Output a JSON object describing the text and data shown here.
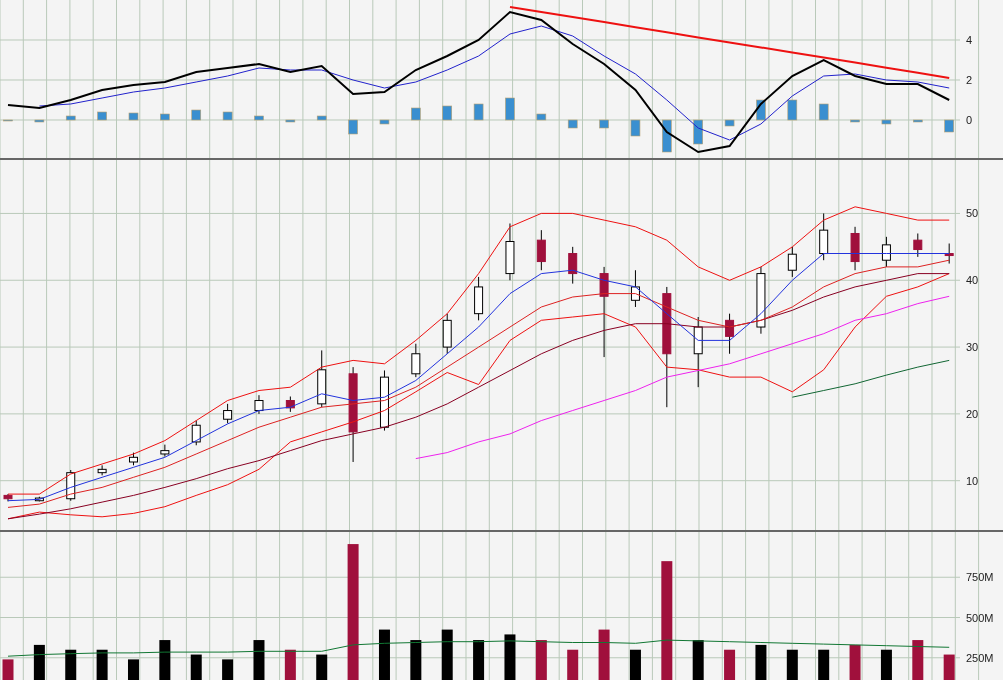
{
  "macd_panel": {
    "chart_data": {
      "type": "line",
      "grid": true,
      "ylim": [
        -1.9,
        6
      ],
      "yticks": [
        0,
        2,
        4
      ],
      "series": [
        {
          "type": "bar",
          "color": "#3a8fd0",
          "values": [
            -0.05,
            -0.1,
            0.2,
            0.4,
            0.35,
            0.3,
            0.5,
            0.4,
            0.2,
            -0.1,
            0.2,
            -0.7,
            -0.2,
            0.6,
            0.7,
            0.8,
            1.1,
            0.3,
            -0.4,
            -0.4,
            -0.8,
            -1.6,
            -1.2,
            -0.3,
            1.0,
            1.0,
            0.8,
            -0.1,
            -0.2,
            -0.1,
            -0.6
          ]
        },
        {
          "type": "line",
          "color": "#2222cc",
          "values": [
            null,
            0.7,
            0.8,
            1.1,
            1.4,
            1.6,
            1.9,
            2.2,
            2.6,
            2.5,
            2.5,
            2.0,
            1.6,
            1.9,
            2.5,
            3.2,
            4.3,
            4.7,
            4.2,
            3.2,
            2.3,
            1.0,
            -0.4,
            -1.0,
            -0.2,
            1.2,
            2.2,
            2.3,
            2.0,
            1.9,
            1.6
          ]
        },
        {
          "type": "line",
          "color": "#000000",
          "values": [
            0.75,
            0.6,
            1.0,
            1.5,
            1.75,
            1.9,
            2.4,
            2.6,
            2.8,
            2.4,
            2.7,
            1.3,
            1.4,
            2.5,
            3.2,
            4.0,
            5.4,
            5.0,
            3.8,
            2.8,
            1.5,
            -0.6,
            -1.6,
            -1.3,
            0.8,
            2.2,
            3.0,
            2.2,
            1.8,
            1.8,
            1.0
          ]
        },
        {
          "type": "line",
          "color": "#ee1111",
          "values": [
            null,
            null,
            null,
            null,
            null,
            null,
            null,
            null,
            null,
            null,
            null,
            null,
            null,
            null,
            null,
            null,
            5.65,
            5.4,
            5.15,
            4.9,
            4.64,
            4.39,
            4.13,
            3.88,
            3.63,
            3.38,
            3.12,
            2.87,
            2.61,
            2.36,
            2.1
          ]
        }
      ]
    }
  },
  "price_panel": {
    "chart_data": {
      "type": "candlestick",
      "grid": true,
      "ylim": [
        2.32,
        58
      ],
      "yticks": [
        10,
        20,
        30,
        40,
        50
      ],
      "ohlc": [
        [
          7.8,
          8.0,
          6.9,
          7.3
        ],
        [
          7.0,
          7.6,
          6.9,
          7.4
        ],
        [
          7.3,
          11.6,
          7.0,
          11.2
        ],
        [
          11.2,
          12.3,
          10.8,
          11.7
        ],
        [
          12.8,
          14.2,
          12.3,
          13.5
        ],
        [
          14.0,
          15.4,
          13.6,
          14.5
        ],
        [
          15.8,
          19.0,
          15.3,
          18.3
        ],
        [
          19.2,
          21.5,
          18.6,
          20.5
        ],
        [
          20.5,
          22.8,
          20.0,
          22.0
        ],
        [
          22.0,
          22.6,
          20.3,
          20.9
        ],
        [
          21.5,
          29.5,
          21.0,
          26.6
        ],
        [
          26.0,
          27.0,
          12.8,
          17.3
        ],
        [
          18.0,
          26.5,
          17.5,
          25.5
        ],
        [
          26.0,
          30.5,
          25.5,
          29
        ],
        [
          30.0,
          35.0,
          29.0,
          34
        ],
        [
          35.0,
          40.5,
          34.0,
          39
        ],
        [
          41.0,
          48.5,
          40.0,
          45.8
        ],
        [
          46.0,
          47.5,
          41.5,
          42.8
        ],
        [
          44.0,
          45.0,
          39.5,
          41
        ],
        [
          41.0,
          42.0,
          28.5,
          37.6
        ],
        [
          37.0,
          41.5,
          36.0,
          39
        ],
        [
          38.0,
          39.0,
          21.0,
          29
        ],
        [
          29.0,
          34.5,
          24.0,
          33
        ],
        [
          34.0,
          35.0,
          29.0,
          31.6
        ],
        [
          33.0,
          42.0,
          32.0,
          41
        ],
        [
          41.5,
          45.0,
          40.5,
          43.9
        ],
        [
          44.0,
          50.0,
          43.0,
          47.5
        ],
        [
          47.0,
          48.0,
          41.5,
          42.8
        ],
        [
          43.0,
          46.5,
          42.0,
          45.3
        ],
        [
          46.0,
          47.0,
          43.5,
          44.6
        ],
        [
          44.0,
          45.5,
          42.5,
          43.9
        ]
      ],
      "series": [
        {
          "type": "line",
          "color": "#ee1111",
          "values": [
            8,
            8,
            11,
            12.5,
            14,
            16,
            19,
            22,
            23.5,
            24,
            27,
            28,
            27.5,
            31,
            35,
            41,
            48,
            50,
            50,
            49,
            48,
            46,
            42,
            40,
            42,
            45,
            49,
            51,
            50,
            49,
            49
          ]
        },
        {
          "type": "line",
          "color": "#ee1111",
          "values": [
            4.3,
            5.3,
            4.9,
            4.6,
            5.1,
            6.1,
            7.8,
            9.4,
            11.7,
            15.8,
            17.3,
            18.8,
            20.5,
            23.3,
            26.2,
            24.4,
            31,
            34,
            34.5,
            35,
            33,
            27,
            26.6,
            25.5,
            25.5,
            23.3,
            26.6,
            33,
            37.6,
            39,
            41
          ]
        },
        {
          "type": "line",
          "color": "#880022",
          "values": [
            4.3,
            5,
            5.8,
            6.8,
            7.8,
            9,
            10.3,
            11.8,
            13,
            14.5,
            16,
            17,
            18,
            19.5,
            21.5,
            24,
            26.5,
            29,
            31,
            32.5,
            33.5,
            33.5,
            33,
            33,
            34,
            35.5,
            37.5,
            39,
            40,
            41,
            41
          ]
        },
        {
          "type": "line",
          "color": "#dd2222",
          "values": [
            6,
            6.5,
            8,
            9,
            10.5,
            12,
            14,
            16,
            18,
            19.5,
            21,
            21.5,
            22,
            24,
            27,
            30,
            33,
            36,
            37.5,
            38,
            38,
            36,
            34,
            33,
            34,
            36,
            39,
            41,
            42,
            42,
            43
          ]
        },
        {
          "type": "line",
          "color": "#2233dd",
          "values": [
            7,
            7.2,
            9,
            10.5,
            12,
            13.5,
            16,
            18.5,
            20.5,
            21,
            23,
            22,
            22.5,
            25,
            29,
            33,
            38,
            41,
            41.5,
            40,
            39,
            35,
            31,
            31,
            35,
            40,
            44,
            44,
            44,
            44,
            44
          ]
        },
        {
          "type": "line",
          "color": "#ee22ee",
          "values": [
            null,
            null,
            null,
            null,
            null,
            null,
            null,
            null,
            null,
            null,
            null,
            null,
            null,
            13.3,
            14.2,
            15.8,
            17,
            19,
            20.5,
            22,
            23.5,
            25.5,
            26.5,
            27.5,
            29,
            30.5,
            32,
            34,
            35,
            36.5,
            37.6
          ]
        },
        {
          "type": "line",
          "color": "#116633",
          "values": [
            null,
            null,
            null,
            null,
            null,
            null,
            null,
            null,
            null,
            null,
            null,
            null,
            null,
            null,
            null,
            null,
            null,
            null,
            null,
            null,
            null,
            null,
            null,
            null,
            null,
            22.5,
            23.5,
            24.5,
            25.8,
            27,
            28
          ]
        }
      ]
    }
  },
  "volume_panel": {
    "chart_data": {
      "type": "bar",
      "grid": true,
      "ylim": [
        112,
        1031
      ],
      "yticks": [
        {
          "value": 250,
          "label": "250M"
        },
        {
          "value": 500,
          "label": "500M"
        },
        {
          "value": 750,
          "label": "750M"
        }
      ],
      "series": [
        {
          "type": "bar",
          "color": "#000000",
          "values": [
            null,
            330,
            300,
            300,
            240,
            360,
            270,
            240,
            360,
            null,
            270,
            null,
            425,
            360,
            425,
            360,
            395,
            null,
            null,
            null,
            300,
            null,
            360,
            null,
            330,
            300,
            300,
            null,
            300,
            null,
            null
          ]
        },
        {
          "type": "bar",
          "color": "#a0103c",
          "values": [
            240,
            null,
            null,
            null,
            null,
            null,
            null,
            null,
            null,
            300,
            null,
            956,
            null,
            null,
            null,
            null,
            null,
            360,
            300,
            425,
            null,
            850,
            null,
            300,
            null,
            null,
            null,
            330,
            null,
            360,
            270
          ]
        },
        {
          "type": "line",
          "color": "#117733",
          "values": [
            260,
            270,
            275,
            280,
            280,
            285,
            285,
            285,
            290,
            290,
            290,
            330,
            340,
            345,
            350,
            350,
            355,
            350,
            345,
            345,
            340,
            360,
            355,
            350,
            345,
            340,
            335,
            330,
            325,
            320,
            315
          ]
        }
      ]
    }
  }
}
